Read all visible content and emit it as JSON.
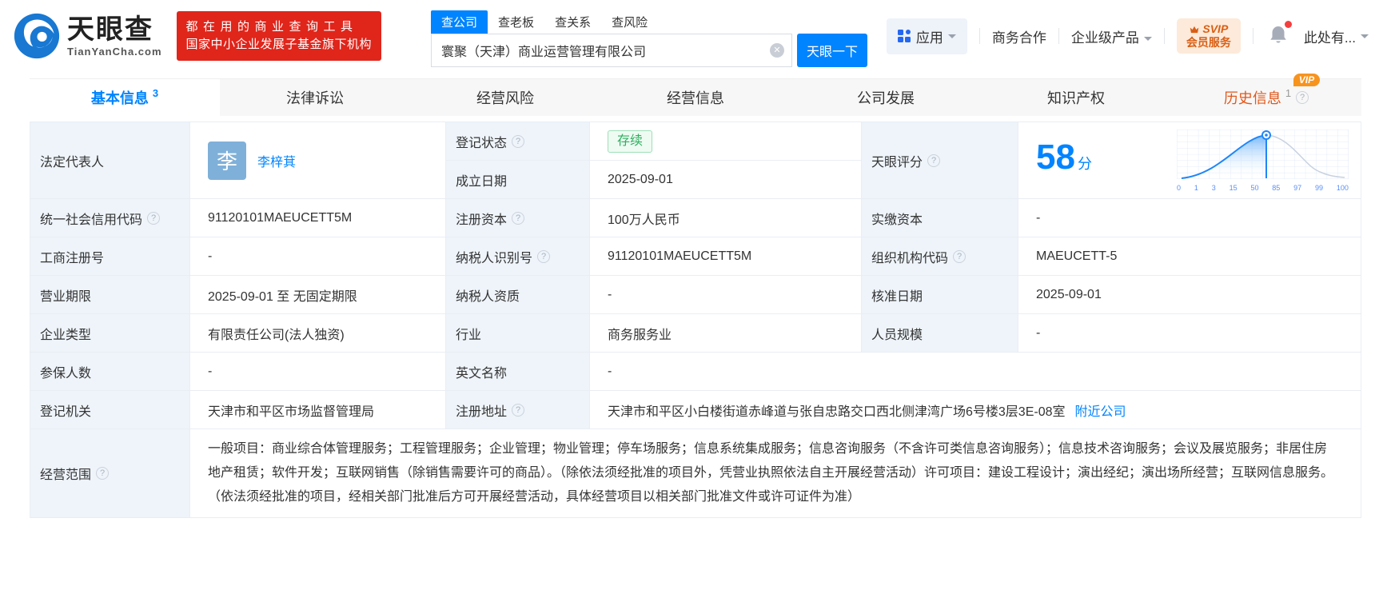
{
  "brand": {
    "name": "天眼查",
    "domain": "TianYanCha.com",
    "slogan1": "都在用的商业查询工具",
    "slogan2": "国家中小企业发展子基金旗下机构"
  },
  "search": {
    "tabs": [
      {
        "label": "查公司"
      },
      {
        "label": "查老板"
      },
      {
        "label": "查关系"
      },
      {
        "label": "查风险"
      }
    ],
    "value": "寰聚（天津）商业运营管理有限公司",
    "button": "天眼一下"
  },
  "topnav": {
    "apps": "应用",
    "cooperation": "商务合作",
    "enterprise": "企业级产品",
    "svip1": "SVIP",
    "svip2": "会员服务",
    "profile": "此处有..."
  },
  "tabs": [
    {
      "label": "基本信息",
      "count": "3"
    },
    {
      "label": "法律诉讼"
    },
    {
      "label": "经营风险"
    },
    {
      "label": "经营信息"
    },
    {
      "label": "公司发展"
    },
    {
      "label": "知识产权"
    },
    {
      "label": "历史信息",
      "count": "1",
      "badge": "VIP"
    }
  ],
  "fields": {
    "legal_rep": {
      "label": "法定代表人",
      "avatar": "李",
      "name": "李梓萁"
    },
    "reg_status": {
      "label": "登记状态",
      "value": "存续"
    },
    "est_date": {
      "label": "成立日期",
      "value": "2025-09-01"
    },
    "score": {
      "label": "天眼评分",
      "value": "58",
      "unit": "分",
      "axis": [
        "0",
        "1",
        "3",
        "15",
        "50",
        "85",
        "97",
        "99",
        "100"
      ]
    },
    "uscc": {
      "label": "统一社会信用代码",
      "value": "91120101MAEUCETT5M"
    },
    "reg_capital": {
      "label": "注册资本",
      "value": "100万人民币"
    },
    "paid_capital": {
      "label": "实缴资本",
      "value": "-"
    },
    "reg_no": {
      "label": "工商注册号",
      "value": "-"
    },
    "taxpayer_id": {
      "label": "纳税人识别号",
      "value": "91120101MAEUCETT5M"
    },
    "org_code": {
      "label": "组织机构代码",
      "value": "MAEUCETT-5"
    },
    "term": {
      "label": "营业期限",
      "value": "2025-09-01 至 无固定期限"
    },
    "taxpayer_qual": {
      "label": "纳税人资质",
      "value": "-"
    },
    "approval_date": {
      "label": "核准日期",
      "value": "2025-09-01"
    },
    "company_type": {
      "label": "企业类型",
      "value": "有限责任公司(法人独资)"
    },
    "industry": {
      "label": "行业",
      "value": "商务服务业"
    },
    "staff": {
      "label": "人员规模",
      "value": "-"
    },
    "insured": {
      "label": "参保人数",
      "value": "-"
    },
    "english_name": {
      "label": "英文名称",
      "value": "-"
    },
    "authority": {
      "label": "登记机关",
      "value": "天津市和平区市场监督管理局"
    },
    "address": {
      "label": "注册地址",
      "value": "天津市和平区小白楼街道赤峰道与张自忠路交口西北侧津湾广场6号楼3层3E-08室",
      "link": "附近公司"
    },
    "scope": {
      "label": "经营范围",
      "value": "一般项目：商业综合体管理服务；工程管理服务；企业管理；物业管理；停车场服务；信息系统集成服务；信息咨询服务（不含许可类信息咨询服务）；信息技术咨询服务；会议及展览服务；非居住房地产租赁；软件开发；互联网销售（除销售需要许可的商品）。（除依法须经批准的项目外，凭营业执照依法自主开展经营活动）许可项目：建设工程设计；演出经纪；演出场所经营；互联网信息服务。（依法须经批准的项目，经相关部门批准后方可开展经营活动，具体经营项目以相关部门批准文件或许可证件为准）"
    }
  },
  "colors": {
    "accent": "#0084ff",
    "danger_red": "#e0251b",
    "status_green": "#2fae5f",
    "history_orange": "#e2571a"
  }
}
